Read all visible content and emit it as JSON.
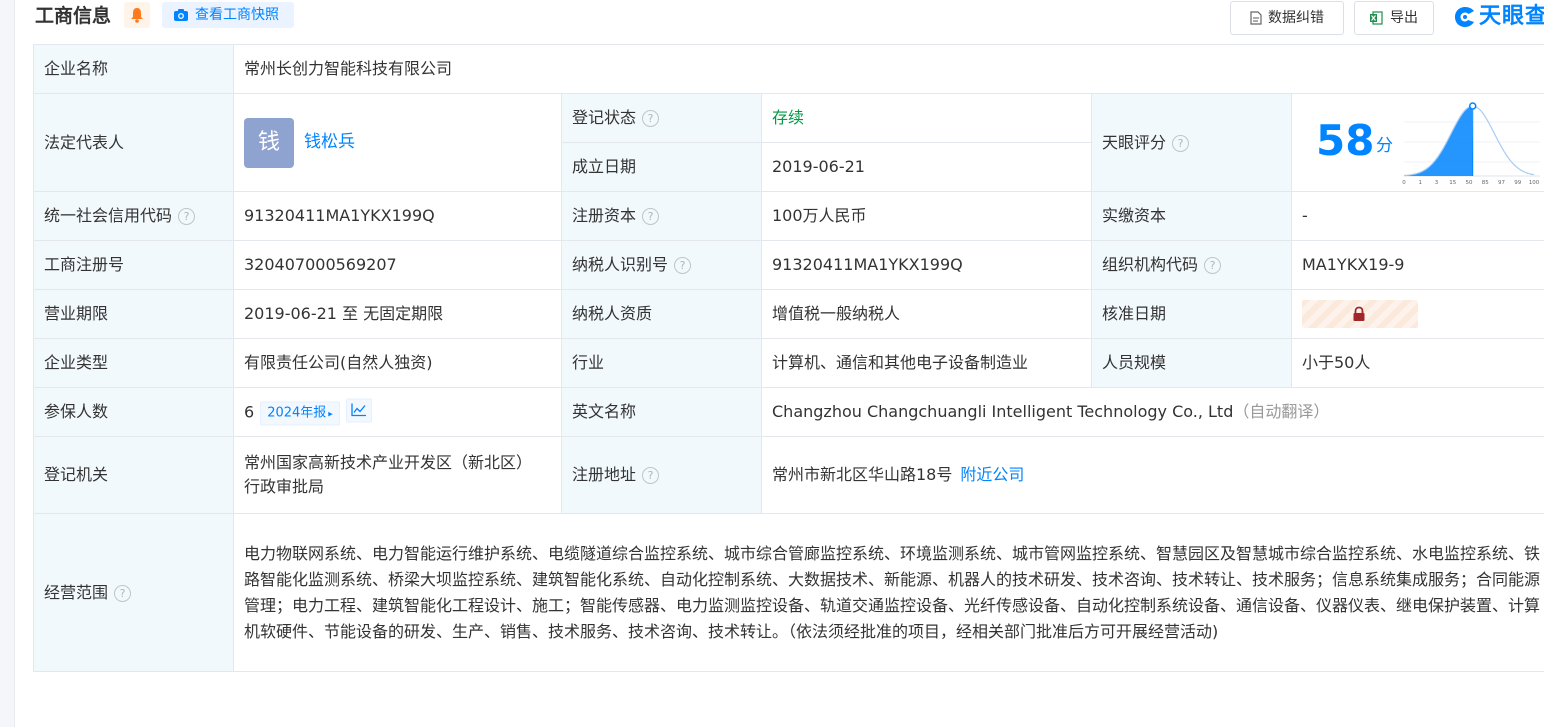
{
  "header": {
    "title": "工商信息",
    "snapshot_btn": "查看工商快照",
    "correct_btn": "数据纠错",
    "export_btn": "导出",
    "brand": "天眼查"
  },
  "colors": {
    "accent": "#0084ff",
    "label_bg": "#f2f9fc",
    "status_green": "#009944",
    "border": "#e4e7ed"
  },
  "icons": [
    "bell-icon",
    "camera-icon",
    "doc-icon",
    "excel-icon",
    "logo-icon",
    "help-icon",
    "trend-chart-icon",
    "lock-icon"
  ],
  "rows": {
    "company_name": {
      "label": "企业名称",
      "value": "常州长创力智能科技有限公司"
    },
    "legal_rep": {
      "label": "法定代表人",
      "avatar_char": "钱",
      "name": "钱松兵"
    },
    "reg_status": {
      "label": "登记状态",
      "value": "存续"
    },
    "found_date": {
      "label": "成立日期",
      "value": "2019-06-21"
    },
    "tianyan_score": {
      "label": "天眼评分",
      "score": "58",
      "unit": "分",
      "score_value": 58,
      "axis_ticks": [
        "0",
        "1",
        "3",
        "15",
        "50",
        "85",
        "97",
        "99",
        "100"
      ]
    },
    "credit_code": {
      "label": "统一社会信用代码",
      "value": "91320411MA1YKX199Q"
    },
    "reg_capital": {
      "label": "注册资本",
      "value": "100万人民币"
    },
    "paid_capital": {
      "label": "实缴资本",
      "value": "-"
    },
    "biz_reg_no": {
      "label": "工商注册号",
      "value": "320407000569207"
    },
    "taxpayer_id": {
      "label": "纳税人识别号",
      "value": "91320411MA1YKX199Q"
    },
    "org_code": {
      "label": "组织机构代码",
      "value": "MA1YKX19-9"
    },
    "biz_term": {
      "label": "营业期限",
      "value": "2019-06-21 至 无固定期限"
    },
    "taxpayer_qual": {
      "label": "纳税人资质",
      "value": "增值税一般纳税人"
    },
    "approve_date": {
      "label": "核准日期"
    },
    "company_type": {
      "label": "企业类型",
      "value": "有限责任公司(自然人独资)"
    },
    "industry": {
      "label": "行业",
      "value": "计算机、通信和其他电子设备制造业"
    },
    "staff_size": {
      "label": "人员规模",
      "value": "小于50人"
    },
    "insured": {
      "label": "参保人数",
      "value": "6",
      "report_tag": "2024年报"
    },
    "english_name": {
      "label": "英文名称",
      "value": "Changzhou Changchuangli Intelligent Technology Co., Ltd",
      "note": "（自动翻译）"
    },
    "reg_authority": {
      "label": "登记机关",
      "value": "常州国家高新技术产业开发区（新北区）行政审批局"
    },
    "reg_address": {
      "label": "注册地址",
      "value": "常州市新北区华山路18号",
      "nearby_link": "附近公司"
    },
    "biz_scope": {
      "label": "经营范围",
      "value": "电力物联网系统、电力智能运行维护系统、电缆隧道综合监控系统、城市综合管廊监控系统、环境监测系统、城市管网监控系统、智慧园区及智慧城市综合监控系统、水电监控系统、铁路智能化监测系统、桥梁大坝监控系统、建筑智能化系统、自动化控制系统、大数据技术、新能源、机器人的技术研发、技术咨询、技术转让、技术服务；信息系统集成服务；合同能源管理；电力工程、建筑智能化工程设计、施工；智能传感器、电力监测监控设备、轨道交通监控设备、光纤传感设备、自动化控制系统设备、通信设备、仪器仪表、继电保护装置、计算机软硬件、节能设备的研发、生产、销售、技术服务、技术咨询、技术转让。（依法须经批准的项目，经相关部门批准后方可开展经营活动)"
    }
  }
}
